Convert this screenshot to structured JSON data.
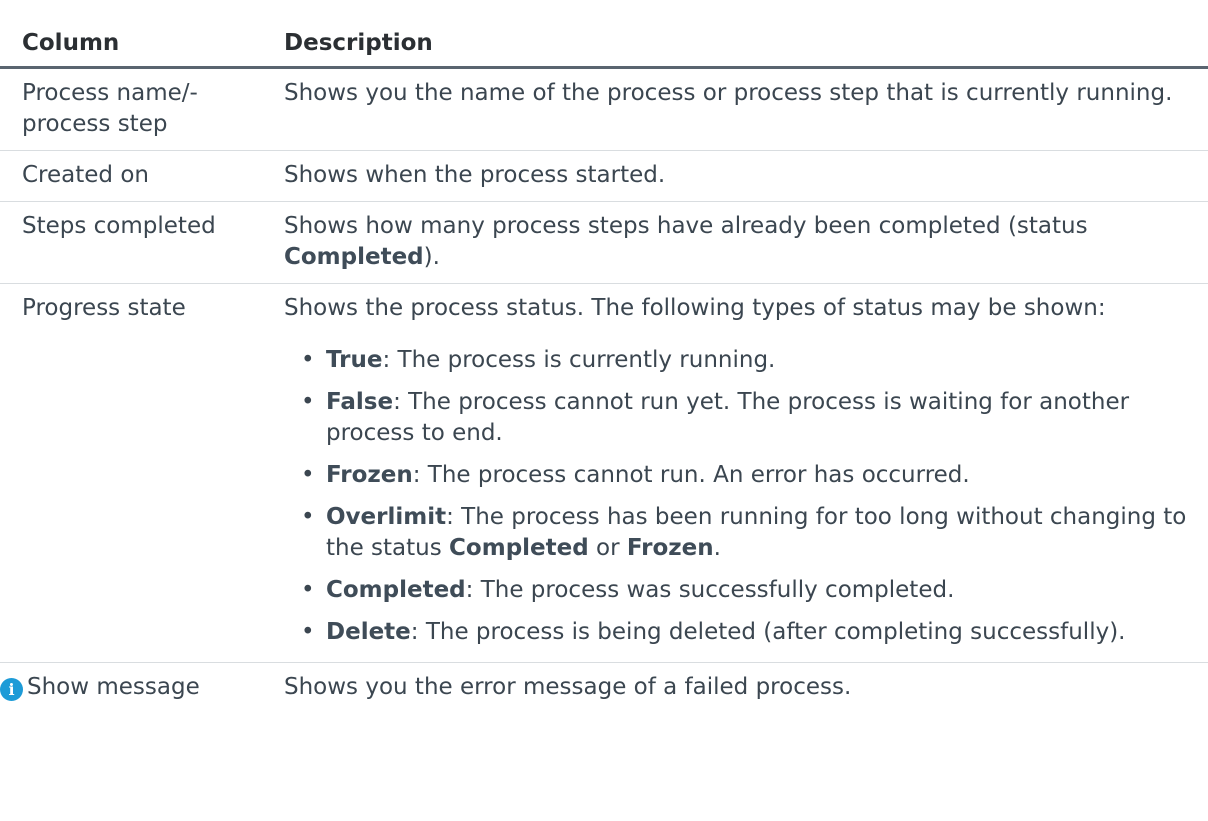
{
  "headers": {
    "column": "Column",
    "description": "Description"
  },
  "rows": [
    {
      "column": "Process name/-\nprocess step",
      "column_lines": [
        "Process name/-",
        "process step"
      ],
      "description": "Shows you the name of the process or process step that is currently running."
    },
    {
      "column": "Created on",
      "description": "Shows when the process started."
    },
    {
      "column": "Steps completed",
      "description_before": "Shows how many process steps have already been completed (status ",
      "description_bold": "Completed",
      "description_after": ")."
    },
    {
      "column": "Progress state",
      "description": "Shows the process status. The following types of status may be shown:",
      "statuses": [
        {
          "name": "True",
          "text": ": The process is currently running."
        },
        {
          "name": "False",
          "text": ": The process cannot run yet. The process is waiting for another process to end."
        },
        {
          "name": "Frozen",
          "text": ": The process cannot run. An error has occurred."
        },
        {
          "name": "Overlimit",
          "text_before": ": The process has been running for too long without changing to the status ",
          "bold1": "Completed",
          "text_mid": " or ",
          "bold2": "Frozen",
          "text_after": "."
        },
        {
          "name": "Completed",
          "text": ": The process was successfully completed."
        },
        {
          "name": "Delete",
          "text": ": The process is being deleted (after completing successfully)."
        }
      ]
    },
    {
      "icon": "info-icon",
      "column": "Show message",
      "description": "Shows you the error message of a failed process."
    }
  ],
  "colors": {
    "info_icon": "#1d9bd7",
    "header_rule": "#5a6570",
    "row_rule": "#d9dde0"
  }
}
